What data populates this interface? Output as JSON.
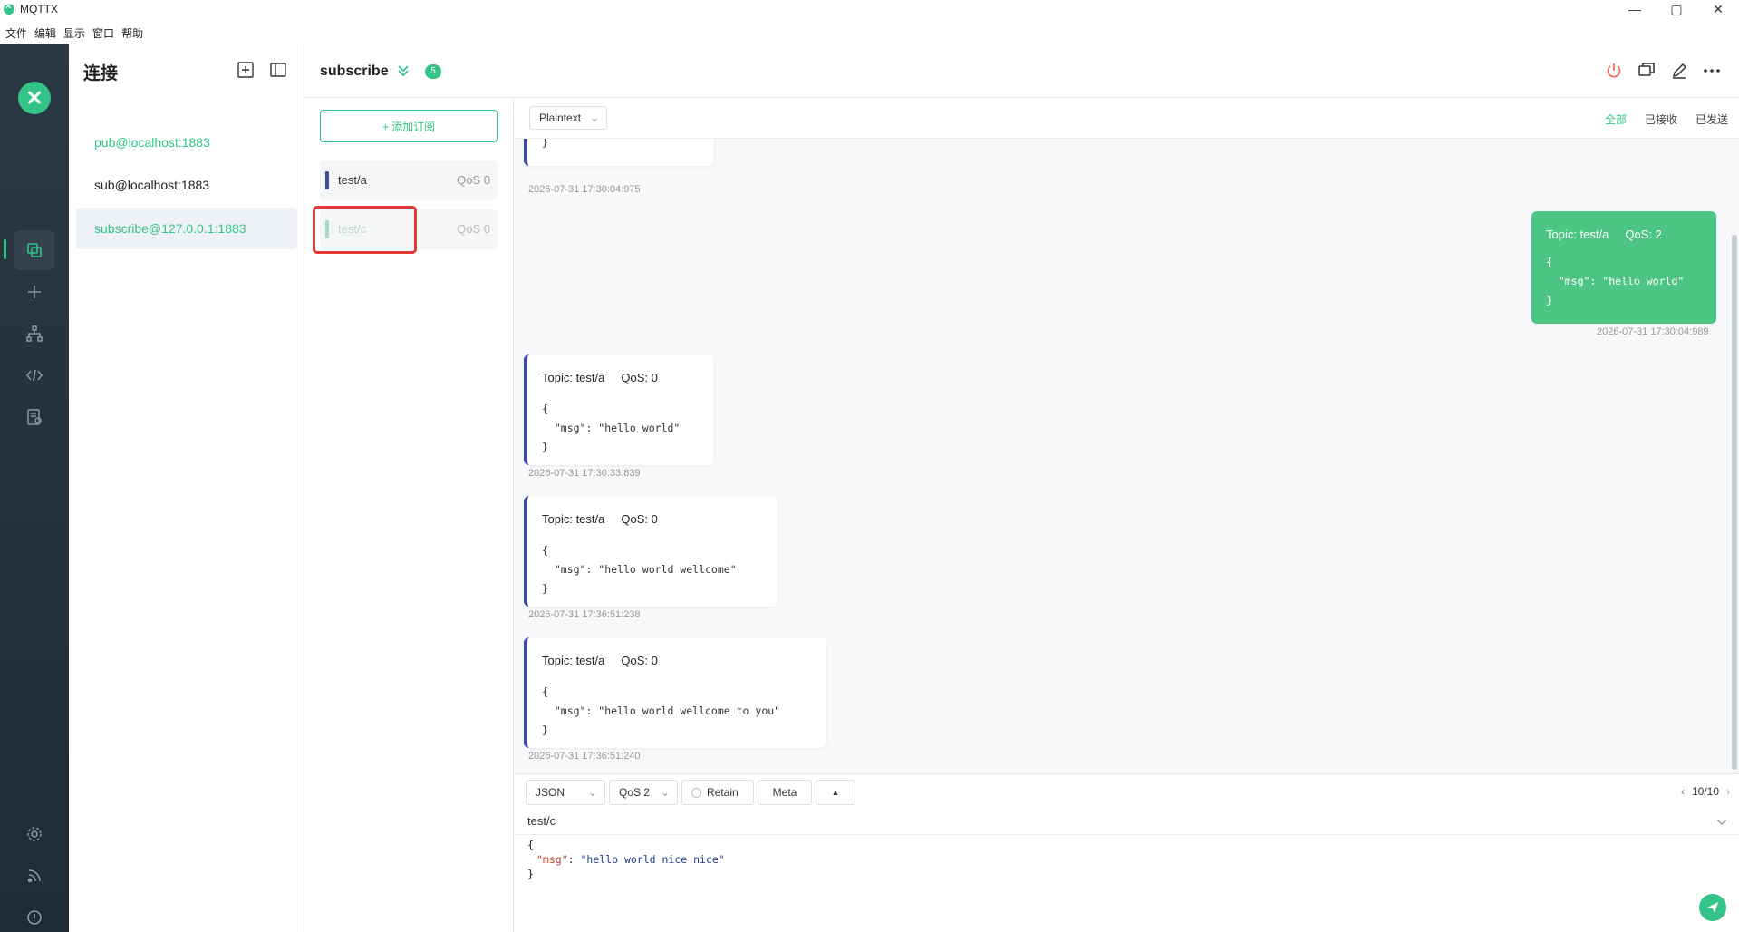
{
  "window": {
    "title": "MQTTX",
    "controls": [
      "—",
      "▢",
      "✕"
    ]
  },
  "menu": [
    "文件",
    "编辑",
    "显示",
    "窗口",
    "帮助"
  ],
  "connections": {
    "title": "连接",
    "items": [
      {
        "label": "pub@localhost:1883"
      },
      {
        "label": "sub@localhost:1883"
      },
      {
        "label": "subscribe@127.0.0.1:1883"
      }
    ]
  },
  "header": {
    "name": "subscribe",
    "badge": "5"
  },
  "subscriptions": {
    "add_label": "+ 添加订阅",
    "items": [
      {
        "topic": "test/a",
        "qos": "QoS 0",
        "color": "#3c4f99"
      },
      {
        "topic": "test/c",
        "qos": "QoS 0",
        "color": "#a8dcc2"
      }
    ]
  },
  "messages": {
    "format": "Plaintext",
    "filters": [
      "全部",
      "已接收",
      "已发送"
    ],
    "list": [
      {
        "body": "}",
        "time": "2026-07-31 17:30:04:975"
      },
      {
        "topic": "Topic: test/a",
        "qos": "QoS: 2",
        "body": "{\n  \"msg\": \"hello world\"\n}",
        "time": "2026-07-31 17:30:04:989"
      },
      {
        "topic": "Topic: test/a",
        "qos": "QoS: 0",
        "body": "{\n  \"msg\": \"hello world\"\n}",
        "time": "2026-07-31 17:30:33:839"
      },
      {
        "topic": "Topic: test/a",
        "qos": "QoS: 0",
        "body": "{\n  \"msg\": \"hello world wellcome\"\n}",
        "time": "2026-07-31 17:36:51:238"
      },
      {
        "topic": "Topic: test/a",
        "qos": "QoS: 0",
        "body": "{\n  \"msg\": \"hello world wellcome to you\"\n}",
        "time": "2026-07-31 17:36:51:240"
      }
    ]
  },
  "composer": {
    "format": "JSON",
    "qos": "QoS 2",
    "retain": "Retain",
    "meta": "Meta",
    "pager": "10/10",
    "topic": "test/c",
    "payload_open": "{",
    "payload_key": "\"msg\"",
    "payload_value": "\"hello world nice nice\"",
    "payload_close": "}"
  },
  "colors": {
    "accent": "#34c388",
    "sidebar": "#2a3944",
    "incoming_bar": "#3c4f99"
  }
}
